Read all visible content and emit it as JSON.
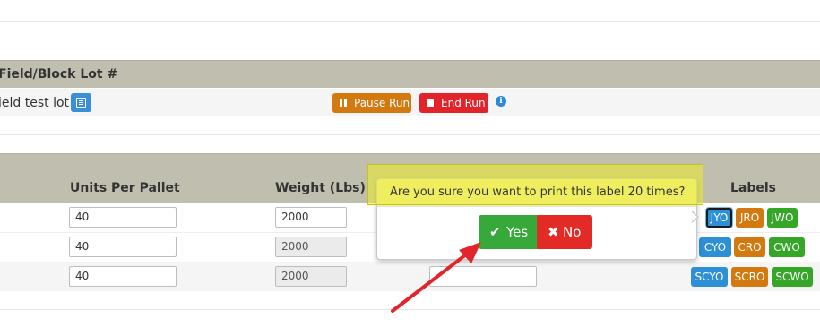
{
  "lot_section": {
    "header_title": "Field/Block Lot #",
    "lot_name": "ield test lot",
    "list_icon": "list-icon",
    "pause_label": "Pause Run",
    "end_label": "End Run",
    "info_icon": "info-icon"
  },
  "grid": {
    "headers": {
      "units_per_pallet": "Units Per Pallet",
      "weight": "Weight (Lbs)",
      "labels": "Labels"
    },
    "rows": [
      {
        "units": "40",
        "weight": "2000",
        "labels": [
          "JYO",
          "JRO",
          "JWO"
        ]
      },
      {
        "units": "40",
        "weight": "2000",
        "labels": [
          "CYO",
          "CRO",
          "CWO"
        ]
      },
      {
        "units": "40",
        "weight": "2000",
        "labels": [
          "SCYO",
          "SCRO",
          "SCWO"
        ]
      }
    ]
  },
  "confirm_popover": {
    "message": "Are you sure you want to print this label 20 times?",
    "yes_label": "Yes",
    "no_label": "No"
  },
  "colors": {
    "header_bg": "#c0bfaf",
    "blue": "#2d8fd5",
    "orange": "#d27a10",
    "green": "#35a628",
    "yes_green": "#37a83a",
    "no_red": "#e22a26",
    "annotation_red": "#e4242b"
  }
}
